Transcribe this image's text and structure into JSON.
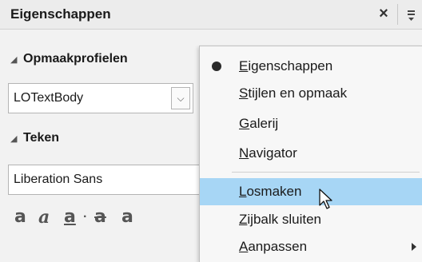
{
  "panel": {
    "title": "Eigenschappen",
    "close_glyph": "×"
  },
  "sections": {
    "styles": {
      "label": "Opmaakprofielen"
    },
    "character": {
      "label": "Teken"
    }
  },
  "style_combo": {
    "value": "LOTextBody"
  },
  "font_name": {
    "value": "Liberation Sans"
  },
  "format_glyphs": [
    "a",
    "a",
    "a",
    "·",
    "a",
    "a"
  ],
  "menu": {
    "items": [
      {
        "underline": "E",
        "rest": "igenschappen",
        "checked": true
      },
      {
        "underline": "S",
        "rest": "tijlen en opmaak"
      },
      {
        "underline": "G",
        "rest": "alerij"
      },
      {
        "underline": "N",
        "rest": "avigator"
      },
      {
        "underline": "L",
        "rest": "osmaken",
        "highlighted": true
      },
      {
        "underline": "Z",
        "rest": "ijbalk sluiten"
      },
      {
        "underline": "A",
        "rest": "anpassen",
        "submenu": true
      }
    ]
  },
  "colors": {
    "highlight": "#a7d6f5",
    "panel_bg": "#f2f2f2"
  }
}
